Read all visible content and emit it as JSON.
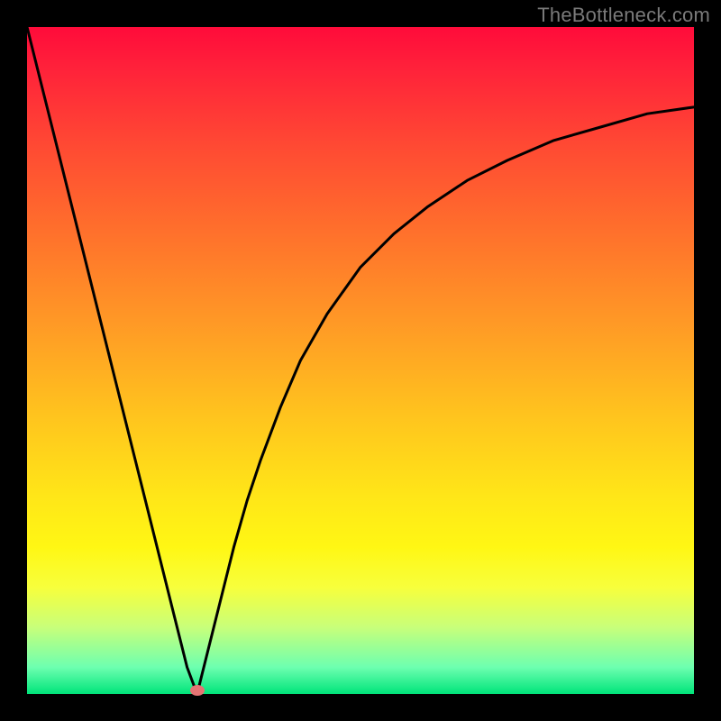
{
  "watermark": "TheBottleneck.com",
  "chart_data": {
    "type": "line",
    "title": "",
    "xlabel": "",
    "ylabel": "",
    "xlim": [
      0,
      100
    ],
    "ylim": [
      0,
      100
    ],
    "grid": false,
    "legend": false,
    "series": [
      {
        "name": "left-branch",
        "x": [
          0,
          2,
          4,
          6,
          8,
          10,
          12,
          14,
          16,
          18,
          20,
          22,
          24,
          25.5
        ],
        "y": [
          100,
          92,
          84,
          76,
          68,
          60,
          52,
          44,
          36,
          28,
          20,
          12,
          4,
          0
        ],
        "color": "#000000"
      },
      {
        "name": "right-branch",
        "x": [
          25.5,
          27,
          29,
          31,
          33,
          35,
          38,
          41,
          45,
          50,
          55,
          60,
          66,
          72,
          79,
          86,
          93,
          100
        ],
        "y": [
          0,
          6,
          14,
          22,
          29,
          35,
          43,
          50,
          57,
          64,
          69,
          73,
          77,
          80,
          83,
          85,
          87,
          88
        ],
        "color": "#000000"
      }
    ],
    "marker": {
      "x": 25.5,
      "y": 0.5,
      "color": "#e57373"
    },
    "background_gradient": {
      "top": "#ff0b3a",
      "bottom": "#00e47a"
    }
  }
}
